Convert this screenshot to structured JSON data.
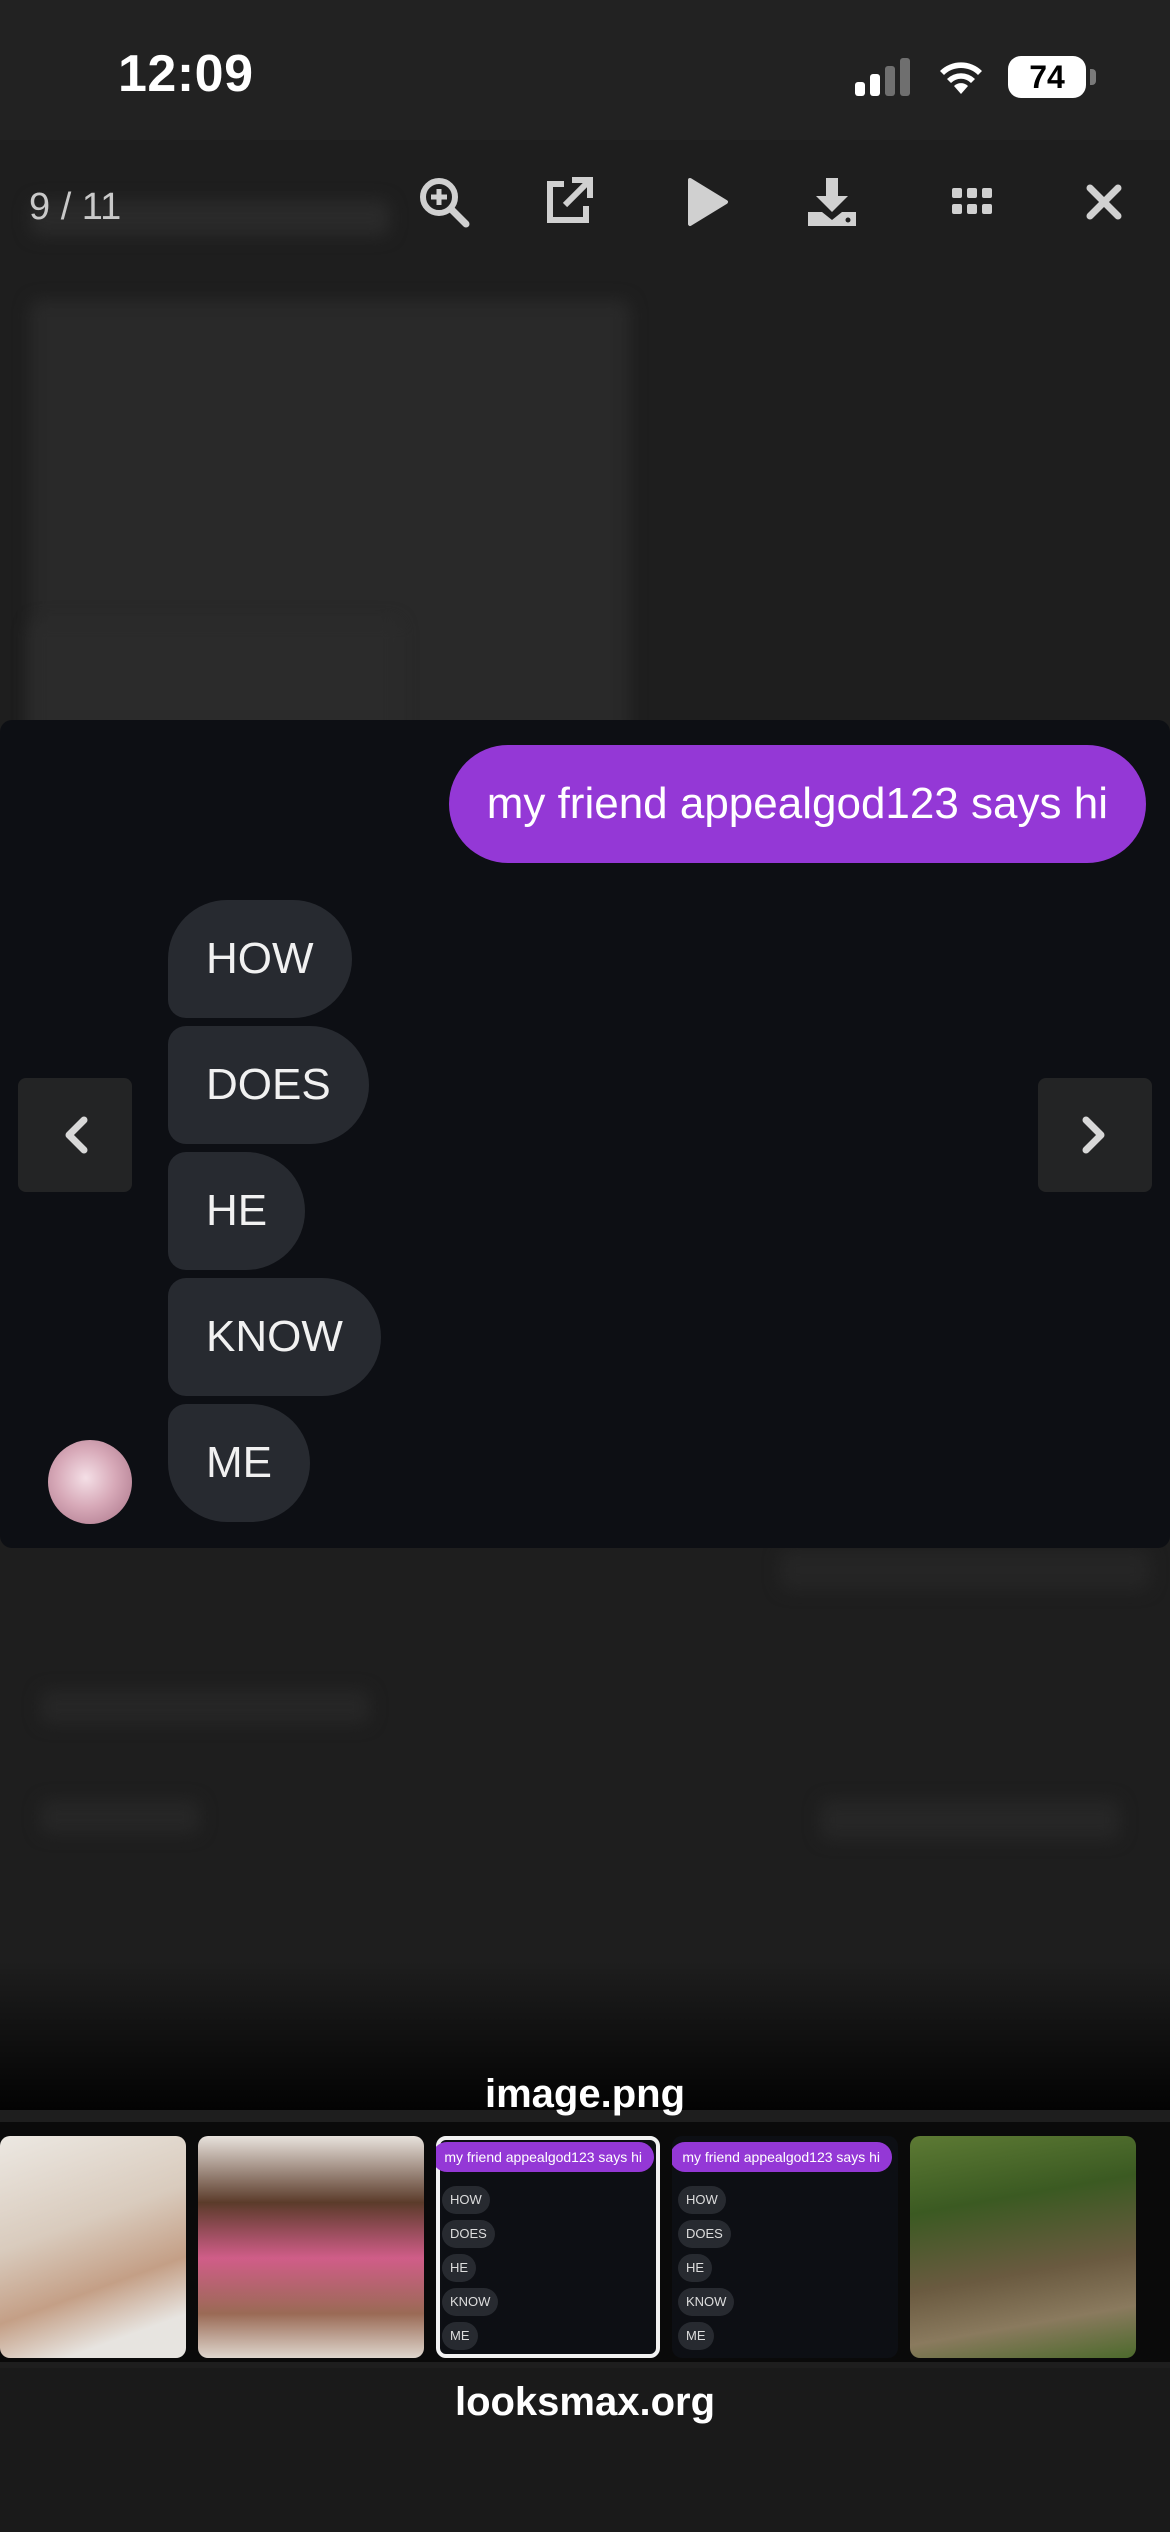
{
  "status_bar": {
    "time": "12:09",
    "battery": "74"
  },
  "lightbox": {
    "counter": "9 / 11",
    "caption": "image.png",
    "toolbar_icons": [
      "zoom-in-icon",
      "external-link-icon",
      "play-icon",
      "download-icon",
      "grid-icon",
      "close-icon"
    ]
  },
  "chat": {
    "sent_message": "my friend appealgod123 says hi",
    "received_messages": [
      "HOW",
      "DOES",
      "HE",
      "KNOW",
      "ME"
    ]
  },
  "thumbnails": {
    "active_index": 2,
    "preview": {
      "sent_message": "my friend appealgod123 says hi",
      "received_messages": [
        "HOW",
        "DOES",
        "HE",
        "KNOW",
        "ME"
      ]
    }
  },
  "footer": {
    "site": "looksmax.org"
  },
  "colors": {
    "sent_bubble": "#9438d6",
    "received_bubble": "#272a30",
    "chat_bg": "#0d0f14"
  }
}
